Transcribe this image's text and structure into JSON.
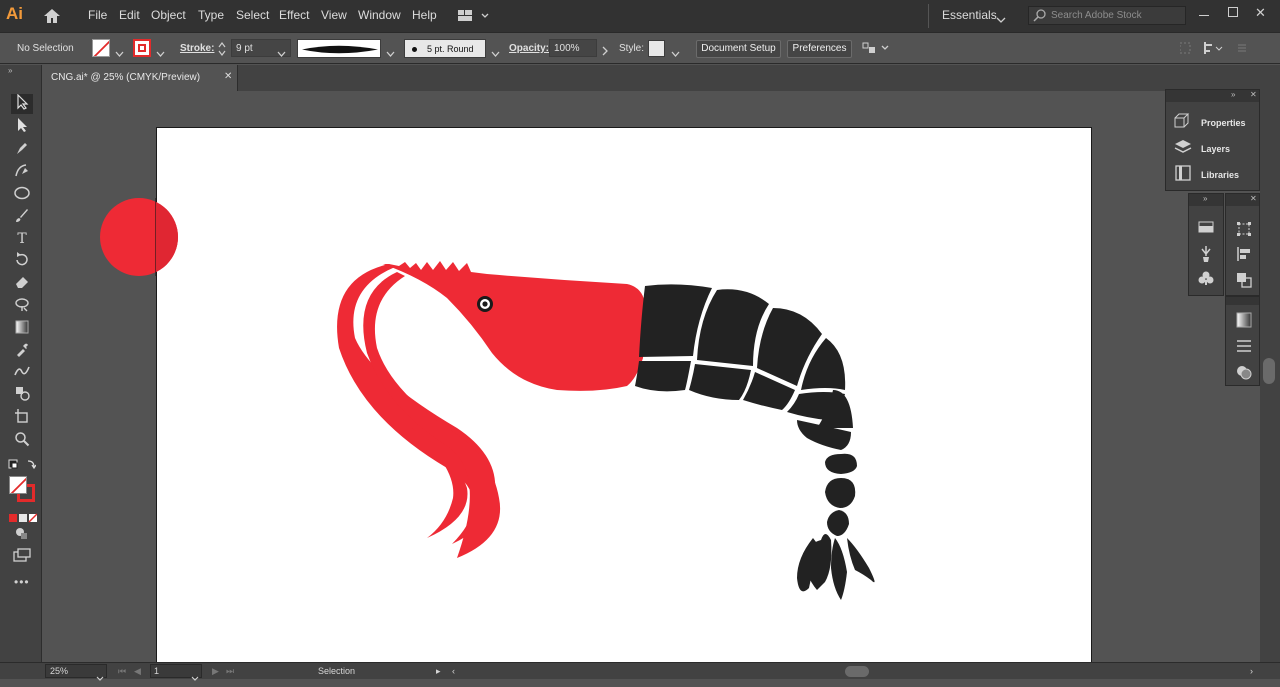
{
  "app": {
    "logo": "Ai"
  },
  "menubar": {
    "items": [
      "File",
      "Edit",
      "Object",
      "Type",
      "Select",
      "Effect",
      "View",
      "Window",
      "Help"
    ],
    "workspace": "Essentials",
    "search_placeholder": "Search Adobe Stock"
  },
  "control_bar": {
    "selection_label": "No Selection",
    "stroke_label": "Stroke:",
    "stroke_weight": "9 pt",
    "brush_label": "5 pt. Round",
    "opacity_label": "Opacity:",
    "opacity_value": "100%",
    "style_label": "Style:",
    "document_setup": "Document Setup",
    "preferences": "Preferences"
  },
  "document": {
    "tab_title": "CNG.ai* @ 25% (CMYK/Preview)",
    "close_glyph": "✕"
  },
  "panels": {
    "main": [
      {
        "label": "Properties",
        "icon": "properties-icon"
      },
      {
        "label": "Layers",
        "icon": "layers-icon"
      },
      {
        "label": "Libraries",
        "icon": "libraries-icon"
      }
    ]
  },
  "status": {
    "zoom": "25%",
    "artboard": "1",
    "tool": "Selection"
  },
  "colors": {
    "shrimp_red": "#ee2a35",
    "shrimp_dark": "#222222",
    "ui_dark": "#323232",
    "ui_mid": "#535353"
  }
}
